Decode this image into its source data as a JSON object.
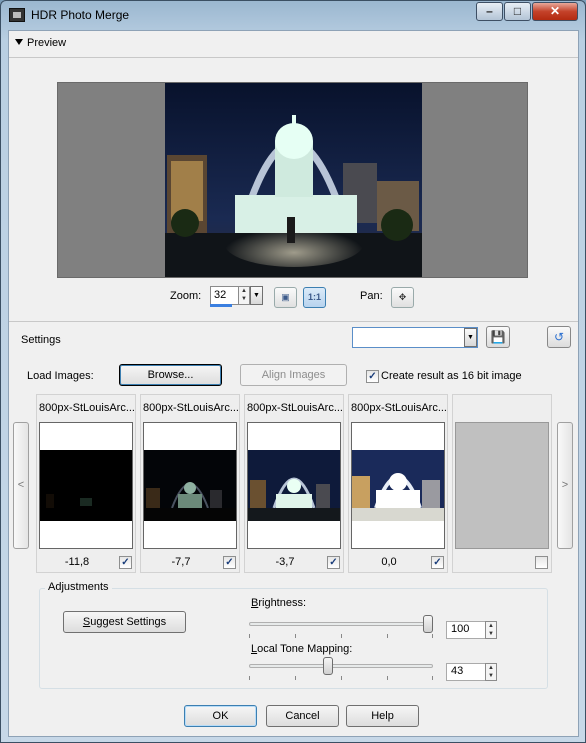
{
  "window": {
    "title": "HDR Photo Merge"
  },
  "preview": {
    "section_label": "Preview"
  },
  "zoom": {
    "label": "Zoom:",
    "value": "32"
  },
  "pan": {
    "label": "Pan:"
  },
  "settings": {
    "label": "Settings",
    "preset_value": ""
  },
  "load": {
    "label": "Load Images:",
    "browse_label": "Browse...",
    "align_label": "Align Images",
    "sixteen_bit_label": "Create result as 16 bit image",
    "sixteen_bit_checked": true
  },
  "images": [
    {
      "name": "800px-StLouisArc...",
      "ev": "-11,8",
      "checked": true
    },
    {
      "name": "800px-StLouisArc...",
      "ev": "-7,7",
      "checked": true
    },
    {
      "name": "800px-StLouisArc...",
      "ev": "-3,7",
      "checked": true
    },
    {
      "name": "800px-StLouisArc...",
      "ev": "0,0",
      "checked": true
    }
  ],
  "empty_slot_checked": false,
  "adjustments": {
    "label": "Adjustments",
    "suggest_label": "Suggest Settings",
    "brightness": {
      "label": "Brightness:",
      "value": "100",
      "level": 1.0
    },
    "local_tone": {
      "label": "Local Tone Mapping:",
      "value": "43",
      "level": 0.43
    }
  },
  "buttons": {
    "ok": "OK",
    "cancel": "Cancel",
    "help": "Help"
  },
  "nav": {
    "prev": "<",
    "next": ">"
  },
  "colors": {
    "accent": "#3c7fb1",
    "preview_bg": "#808080"
  }
}
